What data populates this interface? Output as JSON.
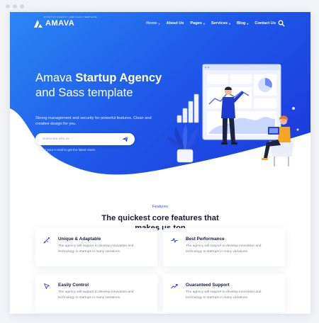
{
  "nav": {
    "logo_tagline": "STARTUP AGENCY AND SAAS TEMPLATE",
    "logo": "AMAVA",
    "items": [
      {
        "label": "Home",
        "dropdown": true,
        "active": true
      },
      {
        "label": "About Us",
        "dropdown": false,
        "active": false
      },
      {
        "label": "Pages",
        "dropdown": true,
        "active": false
      },
      {
        "label": "Services",
        "dropdown": true,
        "active": false
      },
      {
        "label": "Blog",
        "dropdown": true,
        "active": false
      },
      {
        "label": "Contact Us",
        "dropdown": false,
        "active": false
      }
    ],
    "search_icon": "search-icon"
  },
  "hero": {
    "title_part1": "Amava ",
    "title_bold": "Startup Agency",
    "title_part2": " and Sass template",
    "description": "Strong management and security for powerful features. Clean and creative design for you.",
    "subscribe_placeholder": "Subscribe with us",
    "hint": "Enter your e-mail to get the latest news."
  },
  "features": {
    "label": "Features",
    "title": "The quickest core features that makes us top",
    "cards": [
      {
        "title": "Unique & Adaptable",
        "text": "The agency will support to develop innovation and technology to startups in many variations.",
        "icon": "pen-tool-icon"
      },
      {
        "title": "Best Performance",
        "text": "The agency will support to develop innovation and technology to startups in many variations.",
        "icon": "pulse-icon"
      },
      {
        "title": "Easily Control",
        "text": "The agency will support to develop innovation and technology to startups in many variations.",
        "icon": "cursor-icon"
      },
      {
        "title": "Guaranteed Support",
        "text": "The agency will support to develop innovation and technology to startups in many variations.",
        "icon": "trend-up-icon"
      }
    ]
  },
  "colors": {
    "brand_blue": "#1f4fe6",
    "gradient_light": "#2f86f6",
    "accent_orange": "#f5a524",
    "heading_dark": "#17193a"
  }
}
